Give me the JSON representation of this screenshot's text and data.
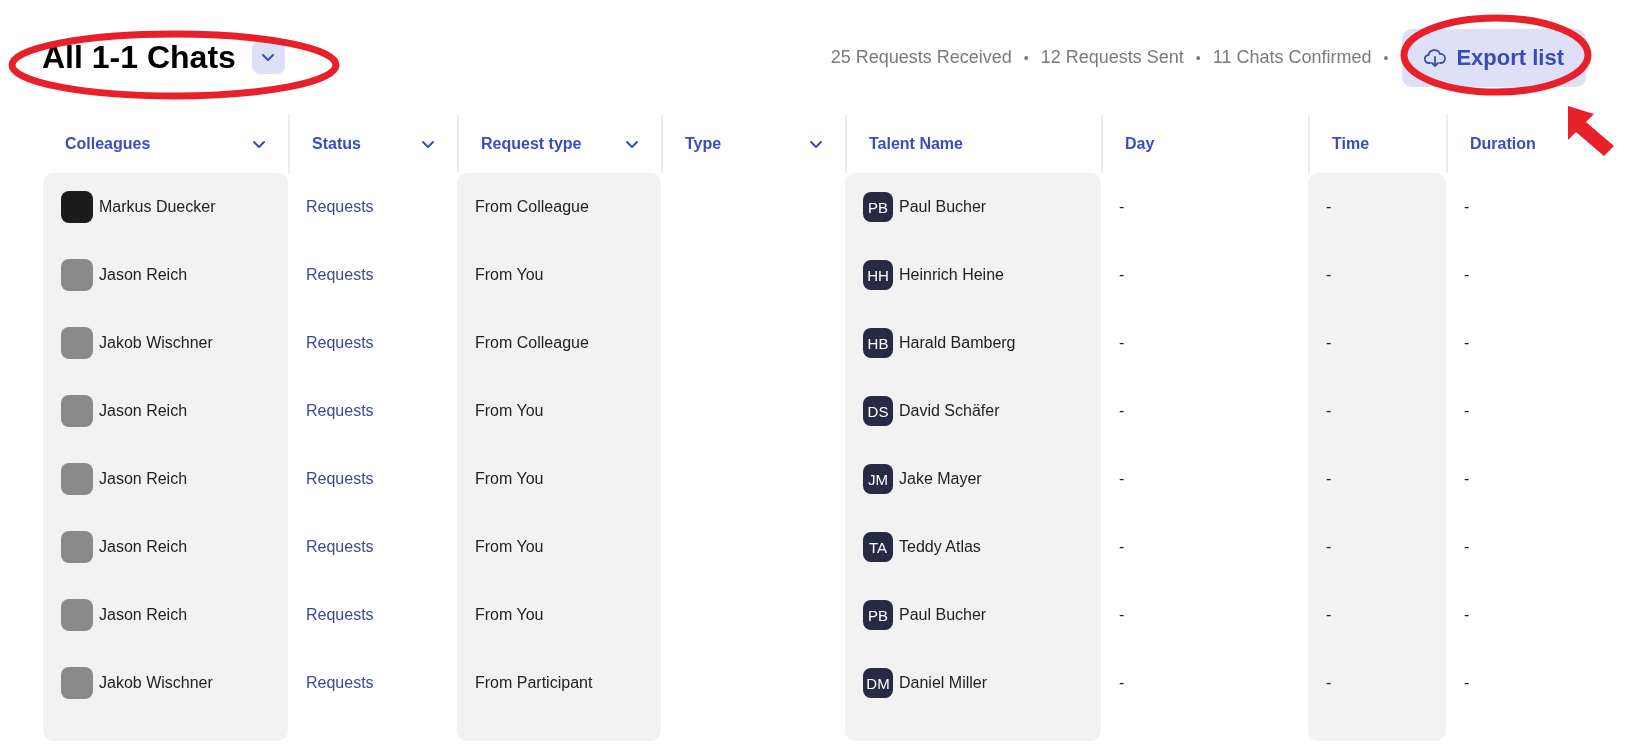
{
  "header": {
    "title": "All 1-1 Chats",
    "stats": [
      "25 Requests Received",
      "12 Requests Sent",
      "11 Chats Confirmed"
    ],
    "separator": "•",
    "export_button": "Export list"
  },
  "table": {
    "columns": [
      {
        "label": "Colleagues",
        "dropdown": true
      },
      {
        "label": "Status",
        "dropdown": true
      },
      {
        "label": "Request type",
        "dropdown": true
      },
      {
        "label": "Type",
        "dropdown": true
      },
      {
        "label": "Talent Name",
        "dropdown": false
      },
      {
        "label": "Day",
        "dropdown": false
      },
      {
        "label": "Time",
        "dropdown": false
      },
      {
        "label": "Duration",
        "dropdown": false
      }
    ],
    "rows": [
      {
        "colleague": "Markus Duecker",
        "status": "Requests",
        "request_type": "From Colleague",
        "talent_initials": "PB",
        "talent_name": "Paul Bucher",
        "day": "-",
        "time": "-",
        "duration": "-"
      },
      {
        "colleague": "Jason Reich",
        "status": "Requests",
        "request_type": "From You",
        "talent_initials": "HH",
        "talent_name": "Heinrich Heine",
        "day": "-",
        "time": "-",
        "duration": "-"
      },
      {
        "colleague": "Jakob Wischner",
        "status": "Requests",
        "request_type": "From Colleague",
        "talent_initials": "HB",
        "talent_name": "Harald Bamberg",
        "day": "-",
        "time": "-",
        "duration": "-"
      },
      {
        "colleague": "Jason Reich",
        "status": "Requests",
        "request_type": "From You",
        "talent_initials": "DS",
        "talent_name": "David Schäfer",
        "day": "-",
        "time": "-",
        "duration": "-"
      },
      {
        "colleague": "Jason Reich",
        "status": "Requests",
        "request_type": "From You",
        "talent_initials": "JM",
        "talent_name": "Jake Mayer",
        "day": "-",
        "time": "-",
        "duration": "-"
      },
      {
        "colleague": "Jason Reich",
        "status": "Requests",
        "request_type": "From You",
        "talent_initials": "TA",
        "talent_name": "Teddy Atlas",
        "day": "-",
        "time": "-",
        "duration": "-"
      },
      {
        "colleague": "Jason Reich",
        "status": "Requests",
        "request_type": "From You",
        "talent_initials": "PB",
        "talent_name": "Paul Bucher",
        "day": "-",
        "time": "-",
        "duration": "-"
      },
      {
        "colleague": "Jakob Wischner",
        "status": "Requests",
        "request_type": "From Participant",
        "talent_initials": "DM",
        "talent_name": "Daniel Miller",
        "day": "-",
        "time": "-",
        "duration": "-"
      }
    ]
  },
  "annotations": [
    {
      "kind": "ellipse"
    },
    {
      "kind": "ellipse"
    },
    {
      "kind": "arrow"
    }
  ]
}
